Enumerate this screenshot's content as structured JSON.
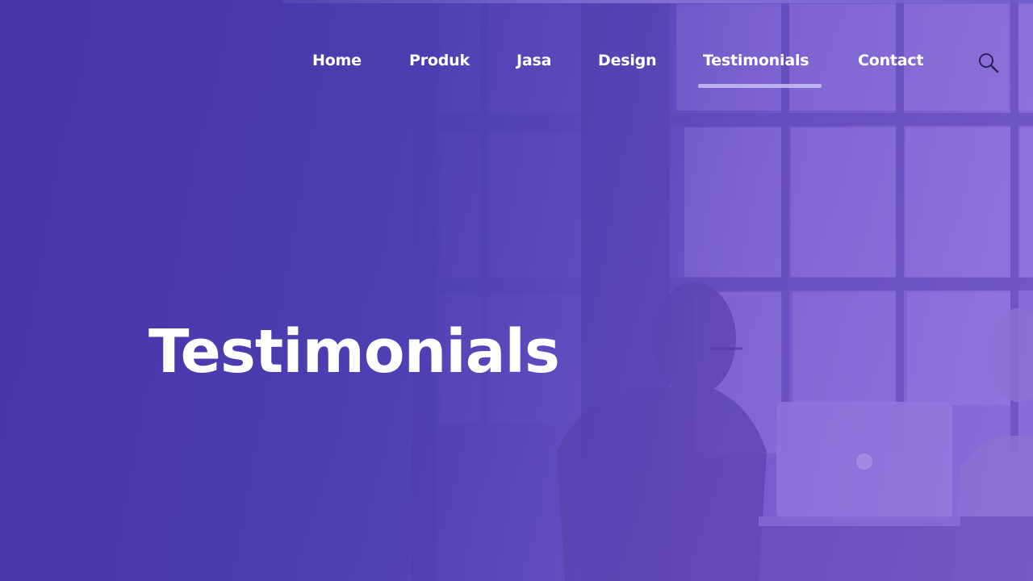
{
  "nav": {
    "items": [
      {
        "label": "Home"
      },
      {
        "label": "Produk"
      },
      {
        "label": "Jasa"
      },
      {
        "label": "Design"
      },
      {
        "label": "Testimonials",
        "active": true
      },
      {
        "label": "Contact"
      }
    ],
    "search_icon": "search-icon"
  },
  "hero": {
    "title": "Testimonials",
    "background": "office-meeting-photo-with-purple-overlay"
  },
  "colors": {
    "overlay_primary": "#4a3fae",
    "overlay_secondary": "#8a70da",
    "text": "#ffffff",
    "active_underline": "#c8bef5"
  }
}
